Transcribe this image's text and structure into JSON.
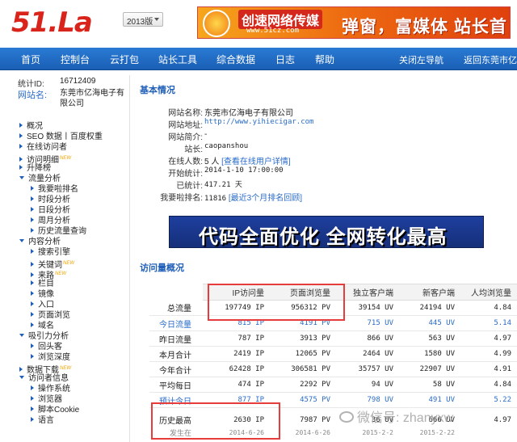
{
  "header": {
    "logo": "51.La",
    "version_select": "2013版",
    "banner": {
      "title": "创速网络传媒",
      "url": "www.51cz.com",
      "slogan": "弹窗，富媒体 站长首选"
    }
  },
  "nav": [
    {
      "label": "首页"
    },
    {
      "label": "控制台"
    },
    {
      "label": "云打包"
    },
    {
      "label": "站长工具"
    },
    {
      "label": "综合数据"
    },
    {
      "label": "日志"
    },
    {
      "label": "帮助"
    },
    {
      "label": "关闭左导航"
    },
    {
      "label": "返回东莞市亿"
    }
  ],
  "sidebar": {
    "stat_id_label": "统计ID:",
    "stat_id": "16712409",
    "site_label": "网站名:",
    "site_name": "东莞市亿海电子有限公司",
    "menu": [
      {
        "label": "概况",
        "level": 0,
        "open": false
      },
      {
        "label": "SEO 数据丨百度权重",
        "level": 0,
        "open": false
      },
      {
        "label": "在线访问者",
        "level": 0,
        "open": false
      },
      {
        "label": "访问明细",
        "level": 0,
        "open": false,
        "new": "NEW"
      },
      {
        "label": "升降榜",
        "level": 0,
        "open": false
      },
      {
        "label": "流量分析",
        "level": 0,
        "open": true
      },
      {
        "label": "我要啦排名",
        "level": 1
      },
      {
        "label": "时段分析",
        "level": 1
      },
      {
        "label": "日段分析",
        "level": 1
      },
      {
        "label": "周月分析",
        "level": 1
      },
      {
        "label": "历史流量查询",
        "level": 1
      },
      {
        "label": "内容分析",
        "level": 0,
        "open": true
      },
      {
        "label": "搜索引擎",
        "level": 1
      },
      {
        "label": "关键词",
        "level": 1,
        "new": "NEW"
      },
      {
        "label": "来路",
        "level": 1,
        "new": "NEW"
      },
      {
        "label": "栏目",
        "level": 1
      },
      {
        "label": "镜像",
        "level": 1
      },
      {
        "label": "入口",
        "level": 1
      },
      {
        "label": "页面浏览",
        "level": 1
      },
      {
        "label": "域名",
        "level": 1
      },
      {
        "label": "吸引力分析",
        "level": 0,
        "open": true
      },
      {
        "label": "回头客",
        "level": 1
      },
      {
        "label": "浏览深度",
        "level": 1
      },
      {
        "label": "数据下载",
        "level": 0,
        "open": false,
        "new": "NEW"
      },
      {
        "label": "访问者信息",
        "level": 0,
        "open": true
      },
      {
        "label": "操作系统",
        "level": 1
      },
      {
        "label": "浏览器",
        "level": 1
      },
      {
        "label": "脚本Cookie",
        "level": 1
      },
      {
        "label": "语言",
        "level": 1
      }
    ]
  },
  "basic": {
    "title": "基本情况",
    "rows": [
      {
        "key": "网站名称:",
        "value": "东莞市亿海电子有限公司"
      },
      {
        "key": "网站地址:",
        "value": "http://www.yihiecigar.com"
      },
      {
        "key": "网站简介:",
        "value": "-"
      },
      {
        "key": "站长:",
        "value": "caopanshou"
      },
      {
        "key": "在线人数:",
        "value": "5 人",
        "link": "[查看在线用户详情]"
      },
      {
        "key": "开始统计:",
        "value": "2014-1-10 17:00:00"
      },
      {
        "key": "已统计:",
        "value": "417.21 天"
      },
      {
        "key": "我要啦排名:",
        "value": "11816",
        "link": "[最近3个月排名回顾]"
      }
    ]
  },
  "ad": {
    "text": "代码全面优化 全网转化最高"
  },
  "overview": {
    "title": "访问量概况",
    "columns": [
      "",
      "IP访问量",
      "页面浏览量",
      "独立客户端",
      "新客户端",
      "人均浏览量"
    ],
    "rows": [
      {
        "label": "总流量",
        "cells": [
          "197749 IP",
          "956312 PV",
          "39154 UV",
          "24194 UV",
          "4.84"
        ],
        "blue": false
      },
      {
        "label": "今日流量",
        "cells": [
          "815 IP",
          "4191 PV",
          "715 UV",
          "445 UV",
          "5.14"
        ],
        "blue": true
      },
      {
        "label": "昨日流量",
        "cells": [
          "787 IP",
          "3913 PV",
          "866 UV",
          "563 UV",
          "4.97"
        ],
        "blue": false
      },
      {
        "label": "本月合计",
        "cells": [
          "2419 IP",
          "12065 PV",
          "2464 UV",
          "1580 UV",
          "4.99"
        ],
        "blue": false
      },
      {
        "label": "今年合计",
        "cells": [
          "62428 IP",
          "306581 PV",
          "35757 UV",
          "22907 UV",
          "4.91"
        ],
        "blue": false
      },
      {
        "label": "平均每日",
        "cells": [
          "474 IP",
          "2292 PV",
          "94 UV",
          "58 UV",
          "4.84"
        ],
        "blue": false
      },
      {
        "label": "预计今日",
        "cells": [
          "877 IP",
          "4575 PV",
          "798 UV",
          "491 UV",
          "5.22"
        ],
        "blue": true
      },
      {
        "label": "历史最高",
        "cells": [
          "2630 IP",
          "7987 PV",
          "36 UV",
          "666 UV",
          "4.97"
        ],
        "blue": false
      },
      {
        "label": "发生在",
        "cells": [
          "2014-6-26",
          "2014-6-26",
          "2015-2-2",
          "2015-2-22",
          ""
        ],
        "blue": false
      }
    ]
  },
  "watermark": "微信号: zhanyxw"
}
